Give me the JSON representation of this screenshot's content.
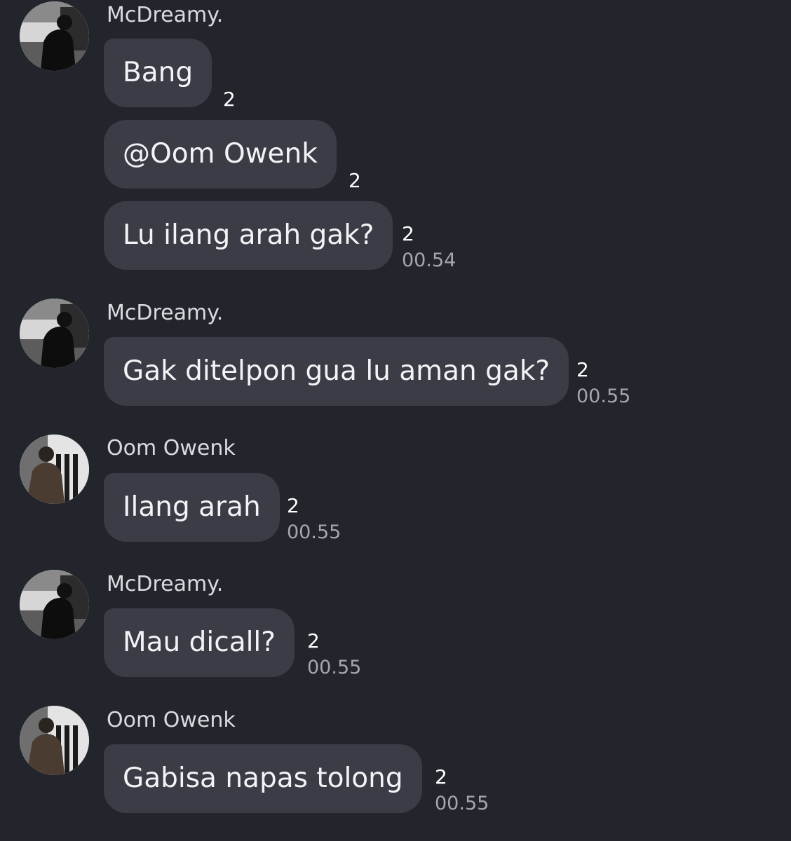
{
  "groups": [
    {
      "sender": "McDreamy.",
      "avatar": "mcdreamy-avatar",
      "messages": [
        {
          "text": "Bang",
          "read": "2",
          "time": ""
        },
        {
          "text": "@Oom Owenk",
          "read": "2",
          "time": ""
        },
        {
          "text": "Lu ilang arah gak?",
          "read": "2",
          "time": "00.54"
        }
      ]
    },
    {
      "sender": "McDreamy.",
      "avatar": "mcdreamy-avatar",
      "messages": [
        {
          "text": "Gak ditelpon gua lu aman gak?",
          "read": "2",
          "time": "00.55"
        }
      ]
    },
    {
      "sender": "Oom Owenk",
      "avatar": "oom-owenk-avatar",
      "messages": [
        {
          "text": "Ilang arah",
          "read": "2",
          "time": "00.55"
        }
      ]
    },
    {
      "sender": "McDreamy.",
      "avatar": "mcdreamy-avatar",
      "messages": [
        {
          "text": "Mau dicall?",
          "read": "2",
          "time": "00.55"
        }
      ]
    },
    {
      "sender": "Oom Owenk",
      "avatar": "oom-owenk-avatar",
      "messages": [
        {
          "text": "Gabisa napas tolong",
          "read": "2",
          "time": "00.55"
        }
      ]
    }
  ],
  "colors": {
    "background": "#22252c",
    "bubble": "#3a3d46",
    "text": "#f2f3f5",
    "timestamp": "#a4a7ad"
  }
}
